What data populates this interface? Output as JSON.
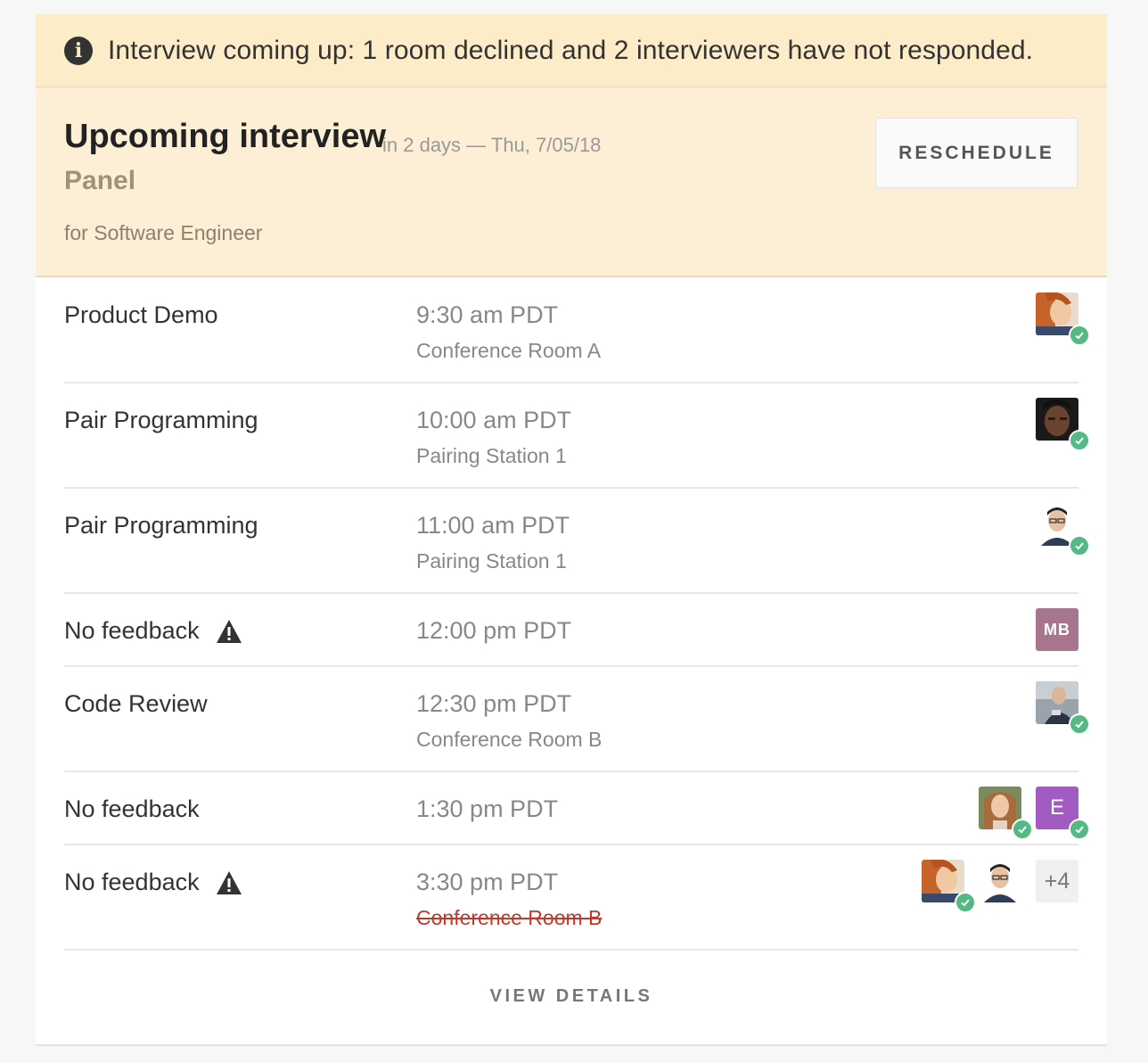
{
  "banner": {
    "icon": "info-icon",
    "text": "Interview coming up: 1 room declined and 2 interviewers have not responded."
  },
  "header": {
    "title": "Upcoming interview",
    "when": "in 2 days — Thu, 7/05/18",
    "type": "Panel",
    "for_line": "for Software Engineer",
    "reschedule_label": "RESCHEDULE"
  },
  "schedule": [
    {
      "label": "Product Demo",
      "time": "9:30 am PDT",
      "room": "Conference Room A",
      "room_declined": false,
      "warning": false
    },
    {
      "label": "Pair Programming",
      "time": "10:00 am PDT",
      "room": "Pairing Station 1",
      "room_declined": false,
      "warning": false
    },
    {
      "label": "Pair Programming",
      "time": "11:00 am PDT",
      "room": "Pairing Station 1",
      "room_declined": false,
      "warning": false
    },
    {
      "label": "No feedback",
      "time": "12:00 pm PDT",
      "room": "",
      "room_declined": false,
      "warning": true,
      "avatar_initials": "MB"
    },
    {
      "label": "Code Review",
      "time": "12:30 pm PDT",
      "room": "Conference Room B",
      "room_declined": false,
      "warning": false
    },
    {
      "label": "No feedback",
      "time": "1:30 pm PDT",
      "room": "",
      "room_declined": false,
      "warning": false,
      "avatar_initials": "E"
    },
    {
      "label": "No feedback",
      "time": "3:30 pm PDT",
      "room": "Conference Room B",
      "room_declined": true,
      "warning": true,
      "more_count": "+4"
    }
  ],
  "footer": {
    "view_details_label": "VIEW DETAILS"
  },
  "colors": {
    "banner_bg": "#fcecc8",
    "header_bg": "#fcefd5",
    "accepted_check": "#55b985",
    "declined_room": "#c0392b",
    "avatar_mb": "#a8758f",
    "avatar_e": "#a35bc4"
  }
}
